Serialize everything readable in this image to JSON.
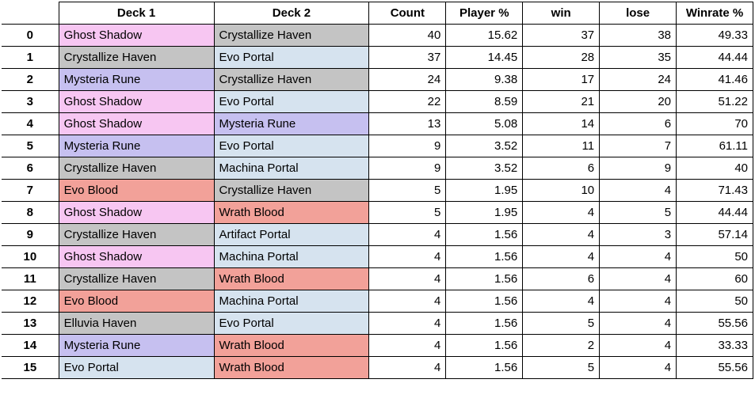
{
  "headers": {
    "deck1": "Deck 1",
    "deck2": "Deck 2",
    "count": "Count",
    "playerpct": "Player %",
    "win": "win",
    "lose": "lose",
    "winrate": "Winrate %"
  },
  "deck_colors": {
    "Ghost Shadow": "c-pink",
    "Crystallize Haven": "c-grey",
    "Mysteria Rune": "c-purple",
    "Evo Blood": "c-red",
    "Elluvia Haven": "c-grey",
    "Evo Portal": "c-blue",
    "Machina Portal": "c-blue",
    "Wrath Blood": "c-red",
    "Artifact Portal": "c-blue"
  },
  "rows": [
    {
      "idx": "0",
      "deck1": "Ghost Shadow",
      "deck2": "Crystallize Haven",
      "count": "40",
      "playerpct": "15.62",
      "win": "37",
      "lose": "38",
      "winrate": "49.33"
    },
    {
      "idx": "1",
      "deck1": "Crystallize Haven",
      "deck2": "Evo Portal",
      "count": "37",
      "playerpct": "14.45",
      "win": "28",
      "lose": "35",
      "winrate": "44.44"
    },
    {
      "idx": "2",
      "deck1": "Mysteria Rune",
      "deck2": "Crystallize Haven",
      "count": "24",
      "playerpct": "9.38",
      "win": "17",
      "lose": "24",
      "winrate": "41.46"
    },
    {
      "idx": "3",
      "deck1": "Ghost Shadow",
      "deck2": "Evo Portal",
      "count": "22",
      "playerpct": "8.59",
      "win": "21",
      "lose": "20",
      "winrate": "51.22"
    },
    {
      "idx": "4",
      "deck1": "Ghost Shadow",
      "deck2": "Mysteria Rune",
      "count": "13",
      "playerpct": "5.08",
      "win": "14",
      "lose": "6",
      "winrate": "70"
    },
    {
      "idx": "5",
      "deck1": "Mysteria Rune",
      "deck2": "Evo Portal",
      "count": "9",
      "playerpct": "3.52",
      "win": "11",
      "lose": "7",
      "winrate": "61.11"
    },
    {
      "idx": "6",
      "deck1": "Crystallize Haven",
      "deck2": "Machina Portal",
      "count": "9",
      "playerpct": "3.52",
      "win": "6",
      "lose": "9",
      "winrate": "40"
    },
    {
      "idx": "7",
      "deck1": "Evo Blood",
      "deck2": "Crystallize Haven",
      "count": "5",
      "playerpct": "1.95",
      "win": "10",
      "lose": "4",
      "winrate": "71.43"
    },
    {
      "idx": "8",
      "deck1": "Ghost Shadow",
      "deck2": "Wrath Blood",
      "count": "5",
      "playerpct": "1.95",
      "win": "4",
      "lose": "5",
      "winrate": "44.44"
    },
    {
      "idx": "9",
      "deck1": "Crystallize Haven",
      "deck2": "Artifact Portal",
      "count": "4",
      "playerpct": "1.56",
      "win": "4",
      "lose": "3",
      "winrate": "57.14"
    },
    {
      "idx": "10",
      "deck1": "Ghost Shadow",
      "deck2": "Machina Portal",
      "count": "4",
      "playerpct": "1.56",
      "win": "4",
      "lose": "4",
      "winrate": "50"
    },
    {
      "idx": "11",
      "deck1": "Crystallize Haven",
      "deck2": "Wrath Blood",
      "count": "4",
      "playerpct": "1.56",
      "win": "6",
      "lose": "4",
      "winrate": "60"
    },
    {
      "idx": "12",
      "deck1": "Evo Blood",
      "deck2": "Machina Portal",
      "count": "4",
      "playerpct": "1.56",
      "win": "4",
      "lose": "4",
      "winrate": "50"
    },
    {
      "idx": "13",
      "deck1": "Elluvia Haven",
      "deck2": "Evo Portal",
      "count": "4",
      "playerpct": "1.56",
      "win": "5",
      "lose": "4",
      "winrate": "55.56"
    },
    {
      "idx": "14",
      "deck1": "Mysteria Rune",
      "deck2": "Wrath Blood",
      "count": "4",
      "playerpct": "1.56",
      "win": "2",
      "lose": "4",
      "winrate": "33.33"
    },
    {
      "idx": "15",
      "deck1": "Evo Portal",
      "deck2": "Wrath Blood",
      "count": "4",
      "playerpct": "1.56",
      "win": "5",
      "lose": "4",
      "winrate": "55.56"
    }
  ]
}
